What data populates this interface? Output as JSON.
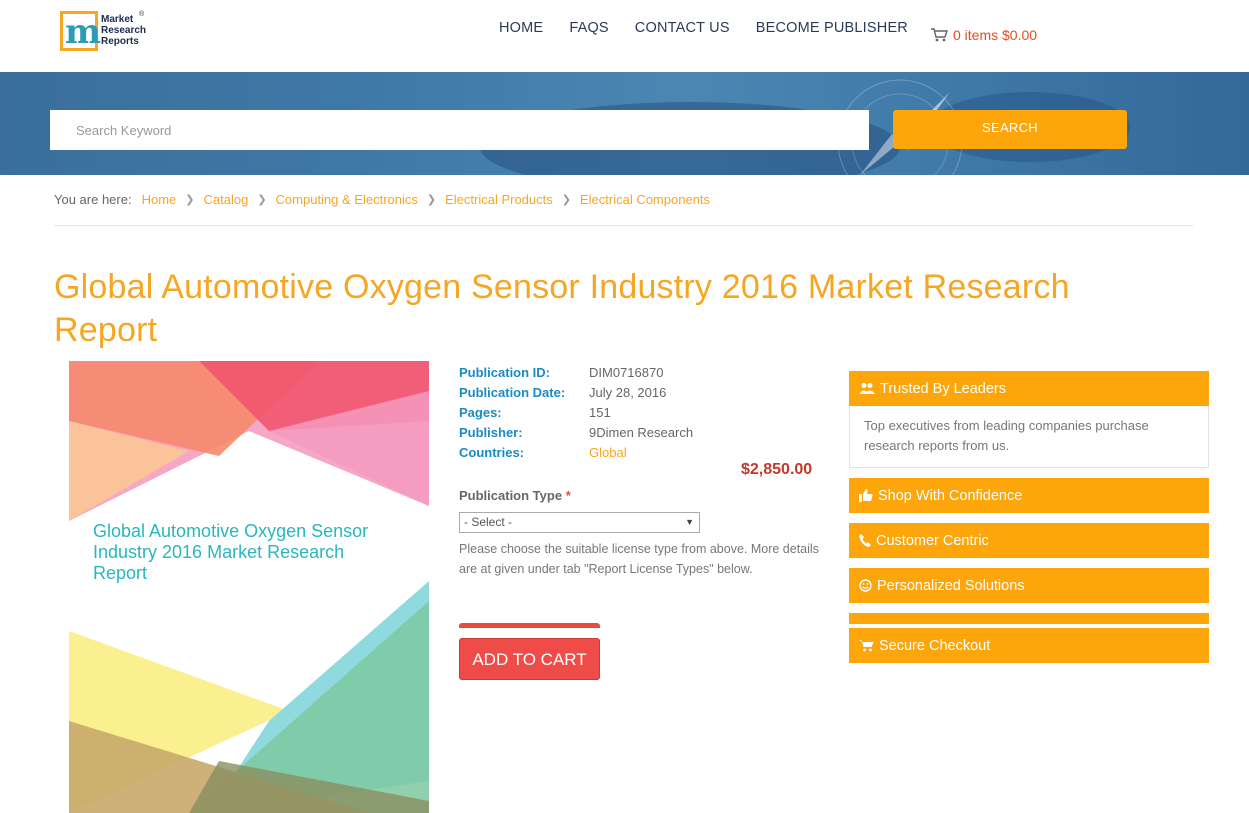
{
  "logo": {
    "line1": "Market",
    "line2": "Research",
    "line3": "Reports",
    "reg": "®",
    "letter": "m"
  },
  "nav": [
    "HOME",
    "FAQS",
    "CONTACT US",
    "BECOME PUBLISHER"
  ],
  "cart": {
    "label": "0 items $0.00"
  },
  "search": {
    "placeholder": "Search Keyword",
    "button": "SEARCH"
  },
  "breadcrumb": {
    "prefix": "You are here:",
    "items": [
      "Home",
      "Catalog",
      "Computing & Electronics",
      "Electrical Products",
      "Electrical Components"
    ]
  },
  "title": "Global Automotive Oxygen Sensor Industry 2016 Market Research Report",
  "cover_title": "Global Automotive Oxygen Sensor Industry 2016 Market Research Report",
  "details": [
    {
      "label": "Publication ID:",
      "value": "DIM0716870"
    },
    {
      "label": "Publication Date:",
      "value": "July 28, 2016"
    },
    {
      "label": "Pages:",
      "value": "151"
    },
    {
      "label": "Publisher:",
      "value": "9Dimen Research"
    },
    {
      "label": "Countries:",
      "value": "Global"
    }
  ],
  "price": "$2,850.00",
  "publication_type": {
    "label": "Publication Type",
    "required": "*",
    "selected": "- Select -"
  },
  "help_text": "Please choose the suitable license type from above. More details are at given under tab \"Report License Types\" below.",
  "add_to_cart": "ADD TO CART",
  "sidebar": {
    "trusted": {
      "title": "Trusted By Leaders",
      "text": "Top executives from leading companies purchase research reports from us."
    },
    "shop": "Shop With Confidence",
    "customer": "Customer Centric",
    "personalized": "Personalized Solutions",
    "secure": "Secure Checkout"
  },
  "colors": {
    "accent": "#fca60b",
    "title": "#f5a623",
    "link": "#1a8ac4",
    "price": "#c0392b",
    "cart_button": "#ef4b48"
  }
}
